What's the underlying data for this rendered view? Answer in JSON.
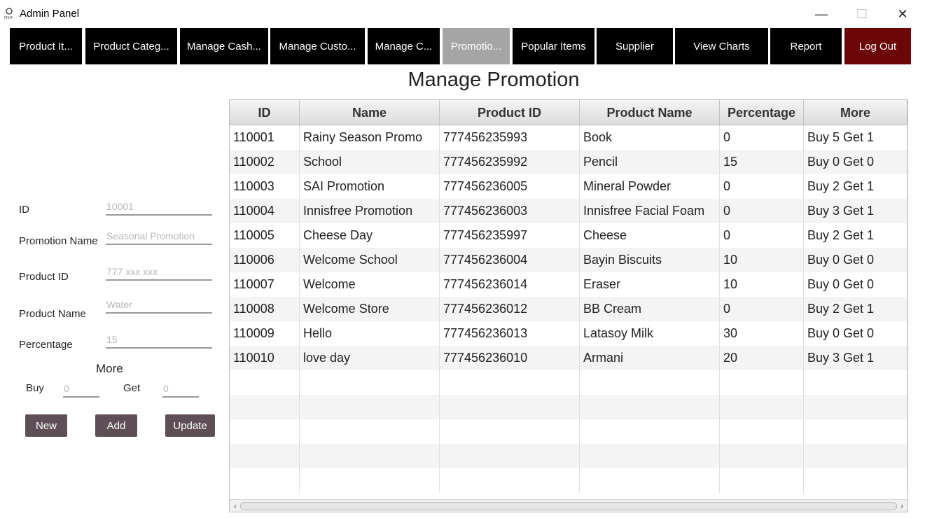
{
  "window": {
    "title": "Admin Panel",
    "icon": "user-icon",
    "controls": {
      "minimize": "—",
      "maximize": "☐",
      "close": "✕"
    }
  },
  "nav": {
    "items": [
      {
        "label": "Product It..."
      },
      {
        "label": "Product Categ..."
      },
      {
        "label": "Manage Cash..."
      },
      {
        "label": "Manage Custo..."
      },
      {
        "label": "Manage C..."
      },
      {
        "label": "Promotio...",
        "active": true
      },
      {
        "label": "Popular Items"
      },
      {
        "label": "Supplier"
      },
      {
        "label": "View Charts"
      },
      {
        "label": "Report"
      },
      {
        "label": "Log Out"
      }
    ],
    "active_color": "#a5a5a5",
    "logout_color": "#6b0707"
  },
  "page": {
    "title": "Manage Promotion"
  },
  "form": {
    "id_label": "ID",
    "id_placeholder": "10001",
    "name_label": "Promotion Name",
    "name_placeholder": "Seasonal Promotion",
    "product_id_label": "Product ID",
    "product_id_placeholder": "777 xxx xxx",
    "product_name_label": "Product Name",
    "product_name_placeholder": "Water",
    "percentage_label": "Percentage",
    "percentage_placeholder": "15",
    "more_label": "More",
    "buy_label": "Buy",
    "buy_placeholder": "0",
    "get_label": "Get",
    "get_placeholder": "0",
    "new_button": "New",
    "add_button": "Add",
    "update_button": "Update"
  },
  "table": {
    "columns": [
      "ID",
      "Name",
      "Product ID",
      "Product Name",
      "Percentage",
      "More"
    ],
    "rows": [
      [
        "110001",
        "Rainy Season Promo",
        "777456235993",
        "Book",
        "0",
        "Buy 5 Get 1"
      ],
      [
        "110002",
        "School",
        "777456235992",
        "Pencil",
        "15",
        "Buy 0 Get 0"
      ],
      [
        "110003",
        "SAI Promotion",
        "777456236005",
        "Mineral Powder",
        "0",
        "Buy 2 Get 1"
      ],
      [
        "110004",
        "Innisfree Promotion",
        "777456236003",
        "Innisfree Facial Foam",
        "0",
        "Buy 3 Get 1"
      ],
      [
        "110005",
        "Cheese Day",
        "777456235997",
        "Cheese",
        "0",
        "Buy 2 Get 1"
      ],
      [
        "110006",
        "Welcome School",
        "777456236004",
        "Bayin Biscuits",
        "10",
        "Buy 0 Get 0"
      ],
      [
        "110007",
        "Welcome",
        "777456236014",
        "Eraser",
        "10",
        "Buy 0 Get 0"
      ],
      [
        "110008",
        "Welcome Store",
        "777456236012",
        "BB Cream",
        "0",
        "Buy 2 Get 1"
      ],
      [
        "110009",
        "Hello",
        "777456236013",
        "Latasoy Milk",
        "30",
        "Buy 0 Get 0"
      ],
      [
        "110010",
        "love day",
        "777456236010",
        "Armani",
        "20",
        "Buy 3 Get 1"
      ]
    ],
    "empty_rows": 5
  },
  "scrollbar": {
    "left_icon": "chevron-left-icon",
    "right_icon": "chevron-right-icon"
  }
}
